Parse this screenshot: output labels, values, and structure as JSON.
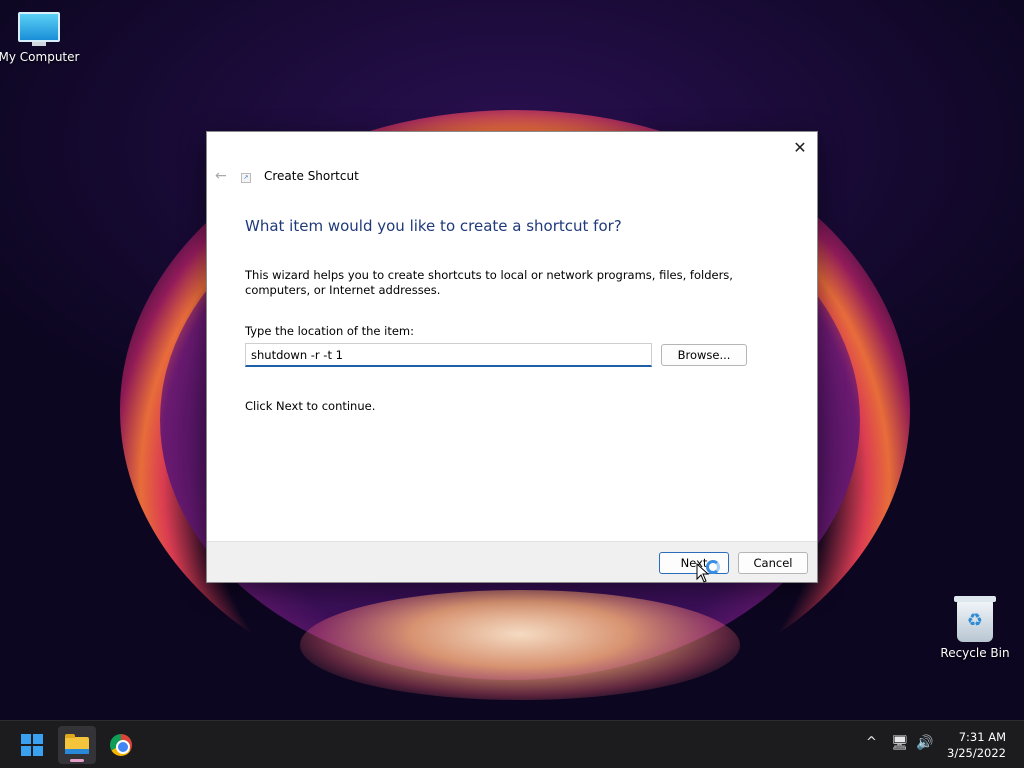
{
  "desktop": {
    "icons": [
      {
        "label": "My Computer"
      },
      {
        "label": "Recycle Bin"
      }
    ]
  },
  "dialog": {
    "title": "Create Shortcut",
    "heading": "What item would you like to create a shortcut for?",
    "description": "This wizard helps you to create shortcuts to local or network programs, files, folders, computers, or Internet addresses.",
    "location_label": "Type the location of the item:",
    "location_value": "shutdown -r -t 1",
    "browse_label": "Browse...",
    "continue_text": "Click Next to continue.",
    "next_label": "Next",
    "cancel_label": "Cancel",
    "close_glyph": "✕",
    "back_glyph": "←"
  },
  "taskbar": {
    "time": "7:31 AM",
    "date": "3/25/2022",
    "tray": {
      "chevron": "^",
      "network_glyph": "🖥",
      "volume_glyph": "🔊"
    }
  },
  "colors": {
    "accent": "#1f5fa8",
    "heading": "#1f3a7a",
    "taskbar": "#1c1c1f"
  }
}
